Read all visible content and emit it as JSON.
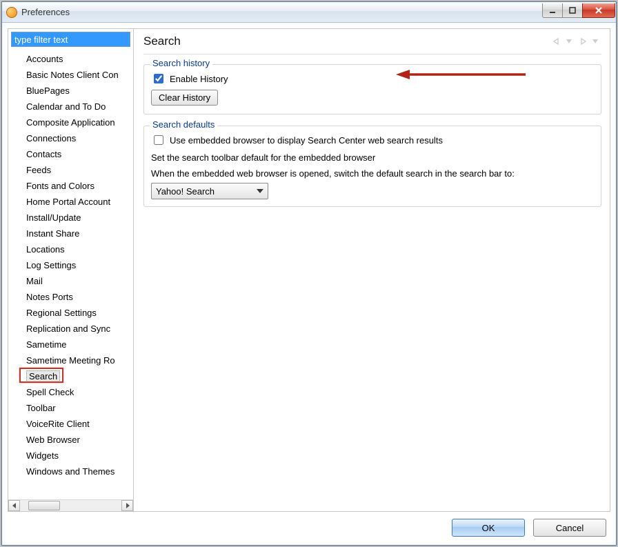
{
  "window": {
    "title": "Preferences"
  },
  "sidebar": {
    "filter_placeholder": "type filter text",
    "items": [
      "Accounts",
      "Basic Notes Client Con",
      "BluePages",
      "Calendar and To Do",
      "Composite Application",
      "Connections",
      "Contacts",
      "Feeds",
      "Fonts and Colors",
      "Home Portal Account",
      "Install/Update",
      "Instant Share",
      "Locations",
      "Log Settings",
      "Mail",
      "Notes Ports",
      "Regional Settings",
      "Replication and Sync",
      "Sametime",
      "Sametime Meeting Ro",
      "Search",
      "Spell Check",
      "Toolbar",
      "VoiceRite Client",
      "Web Browser",
      "Widgets",
      "Windows and Themes"
    ],
    "selected_index": 20
  },
  "content": {
    "heading": "Search",
    "history_group": {
      "legend": "Search history",
      "enable_label": "Enable History",
      "enable_checked": true,
      "clear_button": "Clear History"
    },
    "defaults_group": {
      "legend": "Search defaults",
      "embedded_label": "Use embedded browser to display Search Center web search results",
      "embedded_checked": false,
      "toolbar_default_text": "Set the search toolbar default for the embedded browser",
      "switch_default_text": "When the embedded web browser is opened, switch the default search in the search bar to:",
      "provider_selected": "Yahoo! Search"
    }
  },
  "buttons": {
    "ok": "OK",
    "cancel": "Cancel"
  }
}
